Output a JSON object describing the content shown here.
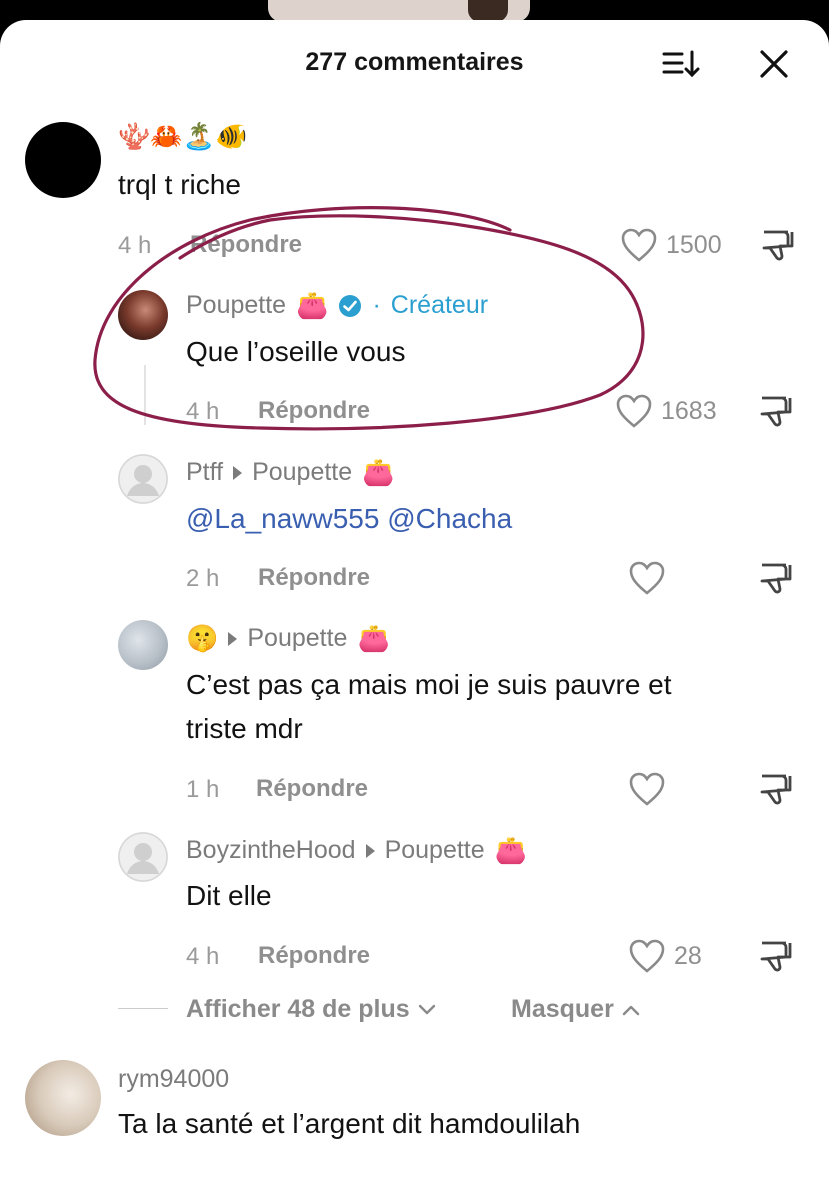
{
  "header": {
    "title": "277 commentaires"
  },
  "colors": {
    "annotation": "#8b1f4a",
    "creator": "#2a9fd0",
    "mention": "#3a5fb0"
  },
  "comments": [
    {
      "name": "🪸🦀🏝️🐠",
      "text": "trql t riche",
      "time": "4 h",
      "reply": "Répondre",
      "likes": "1500"
    },
    {
      "name": "Poupette",
      "name_emoji": "👛",
      "badge": "·",
      "creator_label": "Créateur",
      "text": "Que l’oseille vous",
      "time": "4 h",
      "reply": "Répondre",
      "likes": "1683"
    },
    {
      "name": "Ptff",
      "target": "Poupette",
      "target_emoji": "👛",
      "text_mentions": "@La_naww555 @Chacha",
      "time": "2 h",
      "reply": "Répondre",
      "likes": ""
    },
    {
      "name": "🤫",
      "target": "Poupette",
      "target_emoji": "👛",
      "text_line1": "C’est pas ça mais moi je suis pauvre et",
      "text_line2": "triste mdr",
      "time": "1 h",
      "reply": "Répondre",
      "likes": ""
    },
    {
      "name": "BoyzintheHood",
      "target": "Poupette",
      "target_emoji": "👛",
      "text": "Dit elle",
      "time": "4 h",
      "reply": "Répondre",
      "likes": "28"
    },
    {
      "name": "rym94000",
      "text": "Ta la santé et l’argent dit hamdoulilah"
    }
  ],
  "thread_controls": {
    "show_more": "Afficher 48 de plus",
    "hide": "Masquer"
  }
}
